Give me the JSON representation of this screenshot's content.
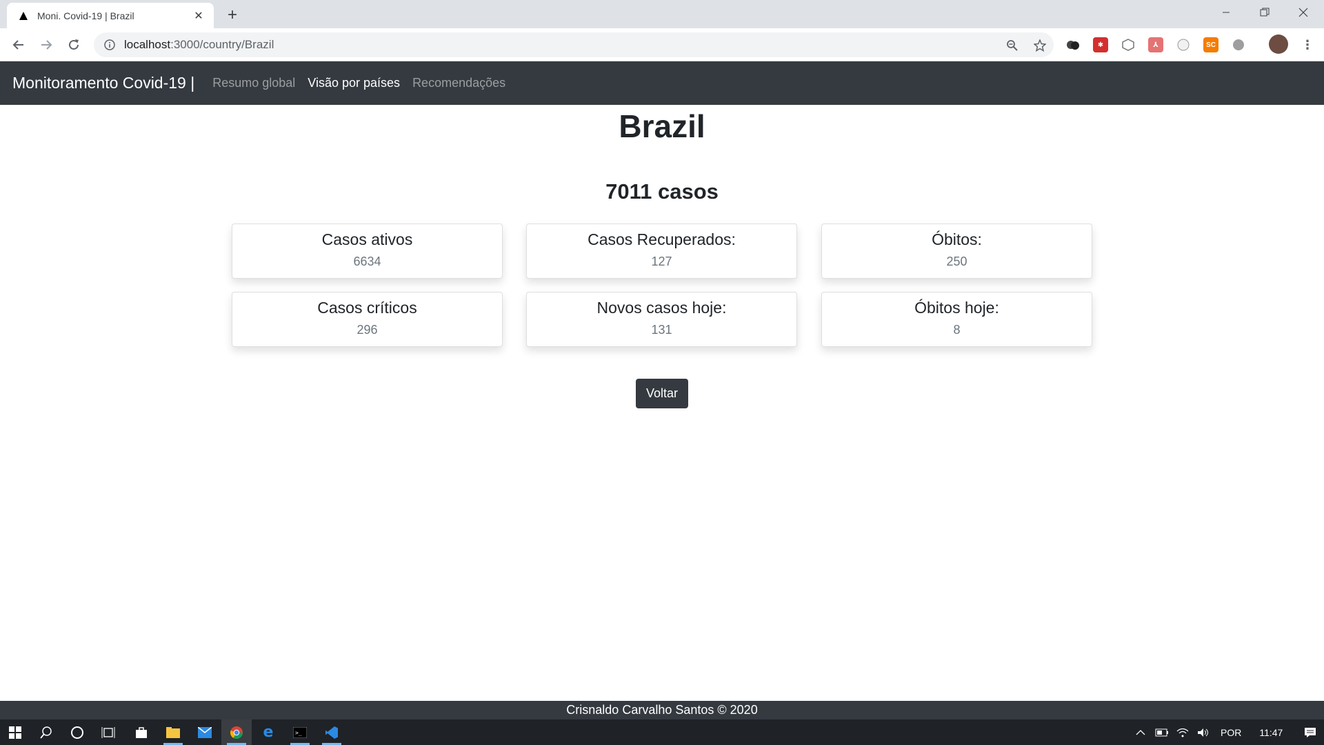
{
  "browser": {
    "tab_title": "Moni. Covid-19 | Brazil",
    "url_host": "localhost",
    "url_path": ":3000/country/Brazil"
  },
  "navbar": {
    "brand": "Monitoramento Covid-19 |",
    "links": [
      {
        "label": "Resumo global",
        "active": false
      },
      {
        "label": "Visão por países",
        "active": true
      },
      {
        "label": "Recomendações",
        "active": false
      }
    ]
  },
  "main": {
    "country": "Brazil",
    "total_cases": "7011 casos",
    "cards": [
      {
        "title": "Casos ativos",
        "value": "6634"
      },
      {
        "title": "Casos Recuperados:",
        "value": "127"
      },
      {
        "title": "Óbitos:",
        "value": "250"
      },
      {
        "title": "Casos críticos",
        "value": "296"
      },
      {
        "title": "Novos casos hoje:",
        "value": "131"
      },
      {
        "title": "Óbitos hoje:",
        "value": "8"
      }
    ],
    "back_button": "Voltar"
  },
  "footer": {
    "text": "Crisnaldo Carvalho Santos © 2020"
  },
  "taskbar": {
    "language": "POR",
    "time": "11:47"
  },
  "colors": {
    "navbar_bg": "#343a40",
    "button_bg": "#343a40"
  }
}
